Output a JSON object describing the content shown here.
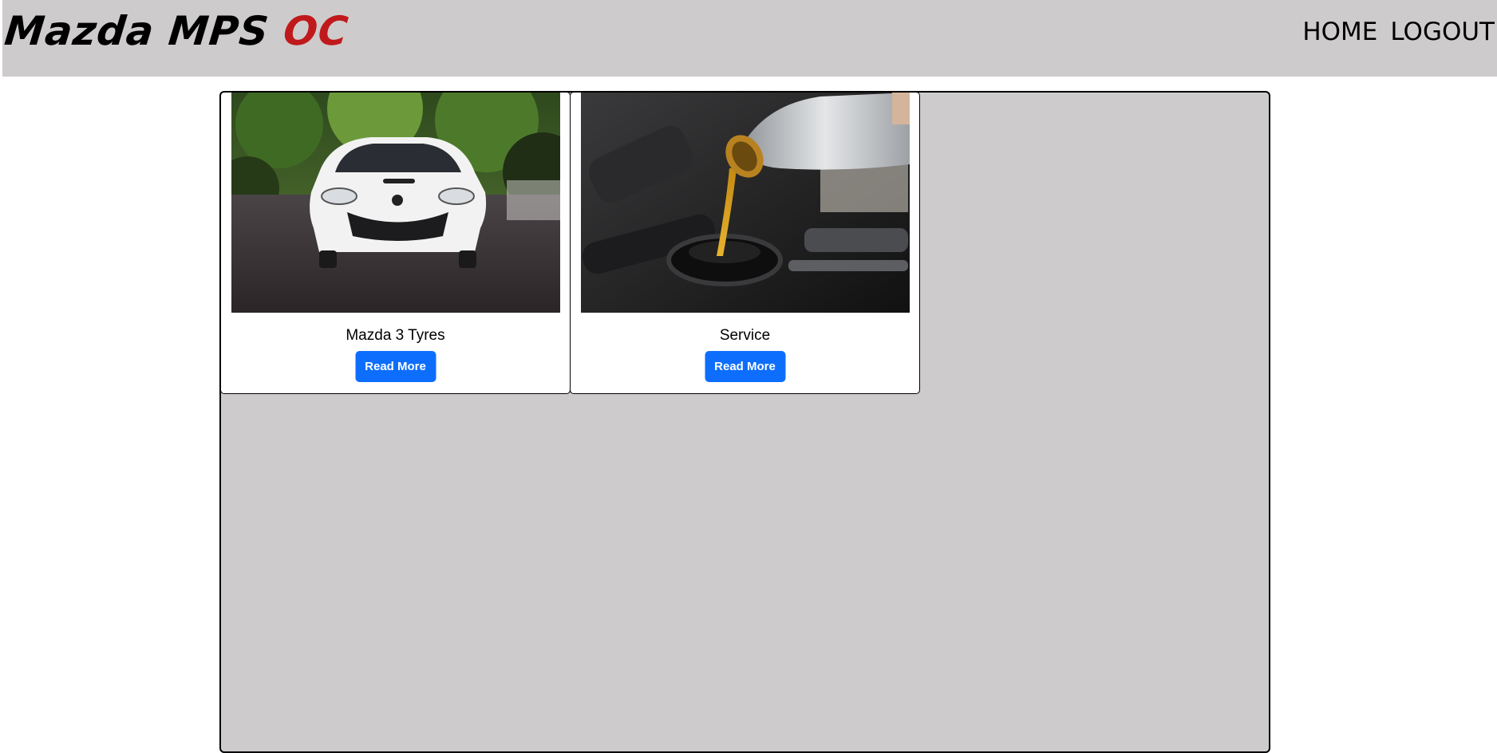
{
  "header": {
    "brand_main": "Mazda MPS",
    "brand_accent": "OC",
    "nav": {
      "home_label": "HOME",
      "logout_label": "LOGOUT"
    }
  },
  "cards": [
    {
      "title": "Mazda 3 Tyres",
      "button_label": "Read More",
      "image_subject": "white Mazda 3 hatchback on road"
    },
    {
      "title": "Service",
      "button_label": "Read More",
      "image_subject": "engine oil being poured into engine"
    }
  ],
  "colors": {
    "header_bg": "#cecbcc",
    "accent_red": "#c0191c",
    "button_blue": "#0d6efd",
    "panel_bg": "#cecbcc"
  }
}
